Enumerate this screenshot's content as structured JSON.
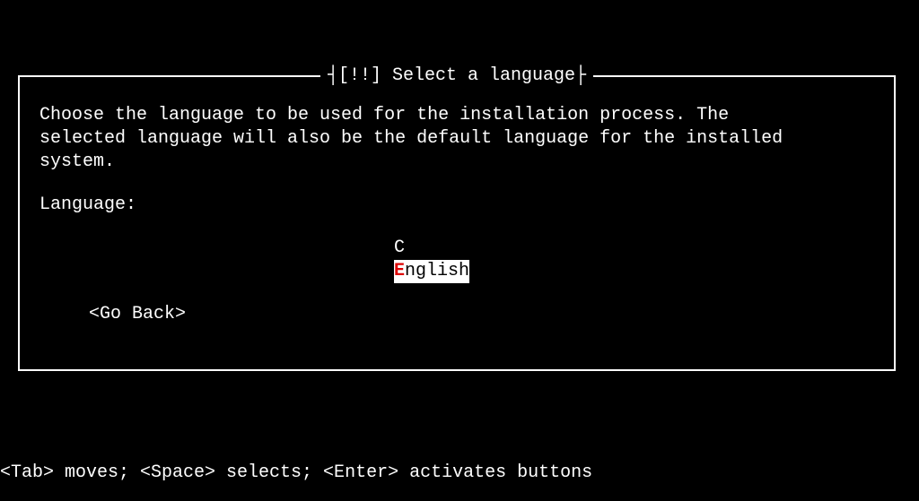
{
  "dialog": {
    "title_prefix": "┤ ",
    "title_text": "[!!] Select a language",
    "title_suffix": " ├",
    "description": "Choose the language to be used for the installation process. The\nselected language will also be the default language for the installed\nsystem.",
    "field_label": "Language:",
    "options": [
      {
        "label": "C",
        "selected": false
      },
      {
        "label_hotkey": "E",
        "label_rest": "nglish",
        "selected": true
      }
    ],
    "go_back_label": "<Go Back>"
  },
  "footer": {
    "help_text": "<Tab> moves; <Space> selects; <Enter> activates buttons"
  }
}
